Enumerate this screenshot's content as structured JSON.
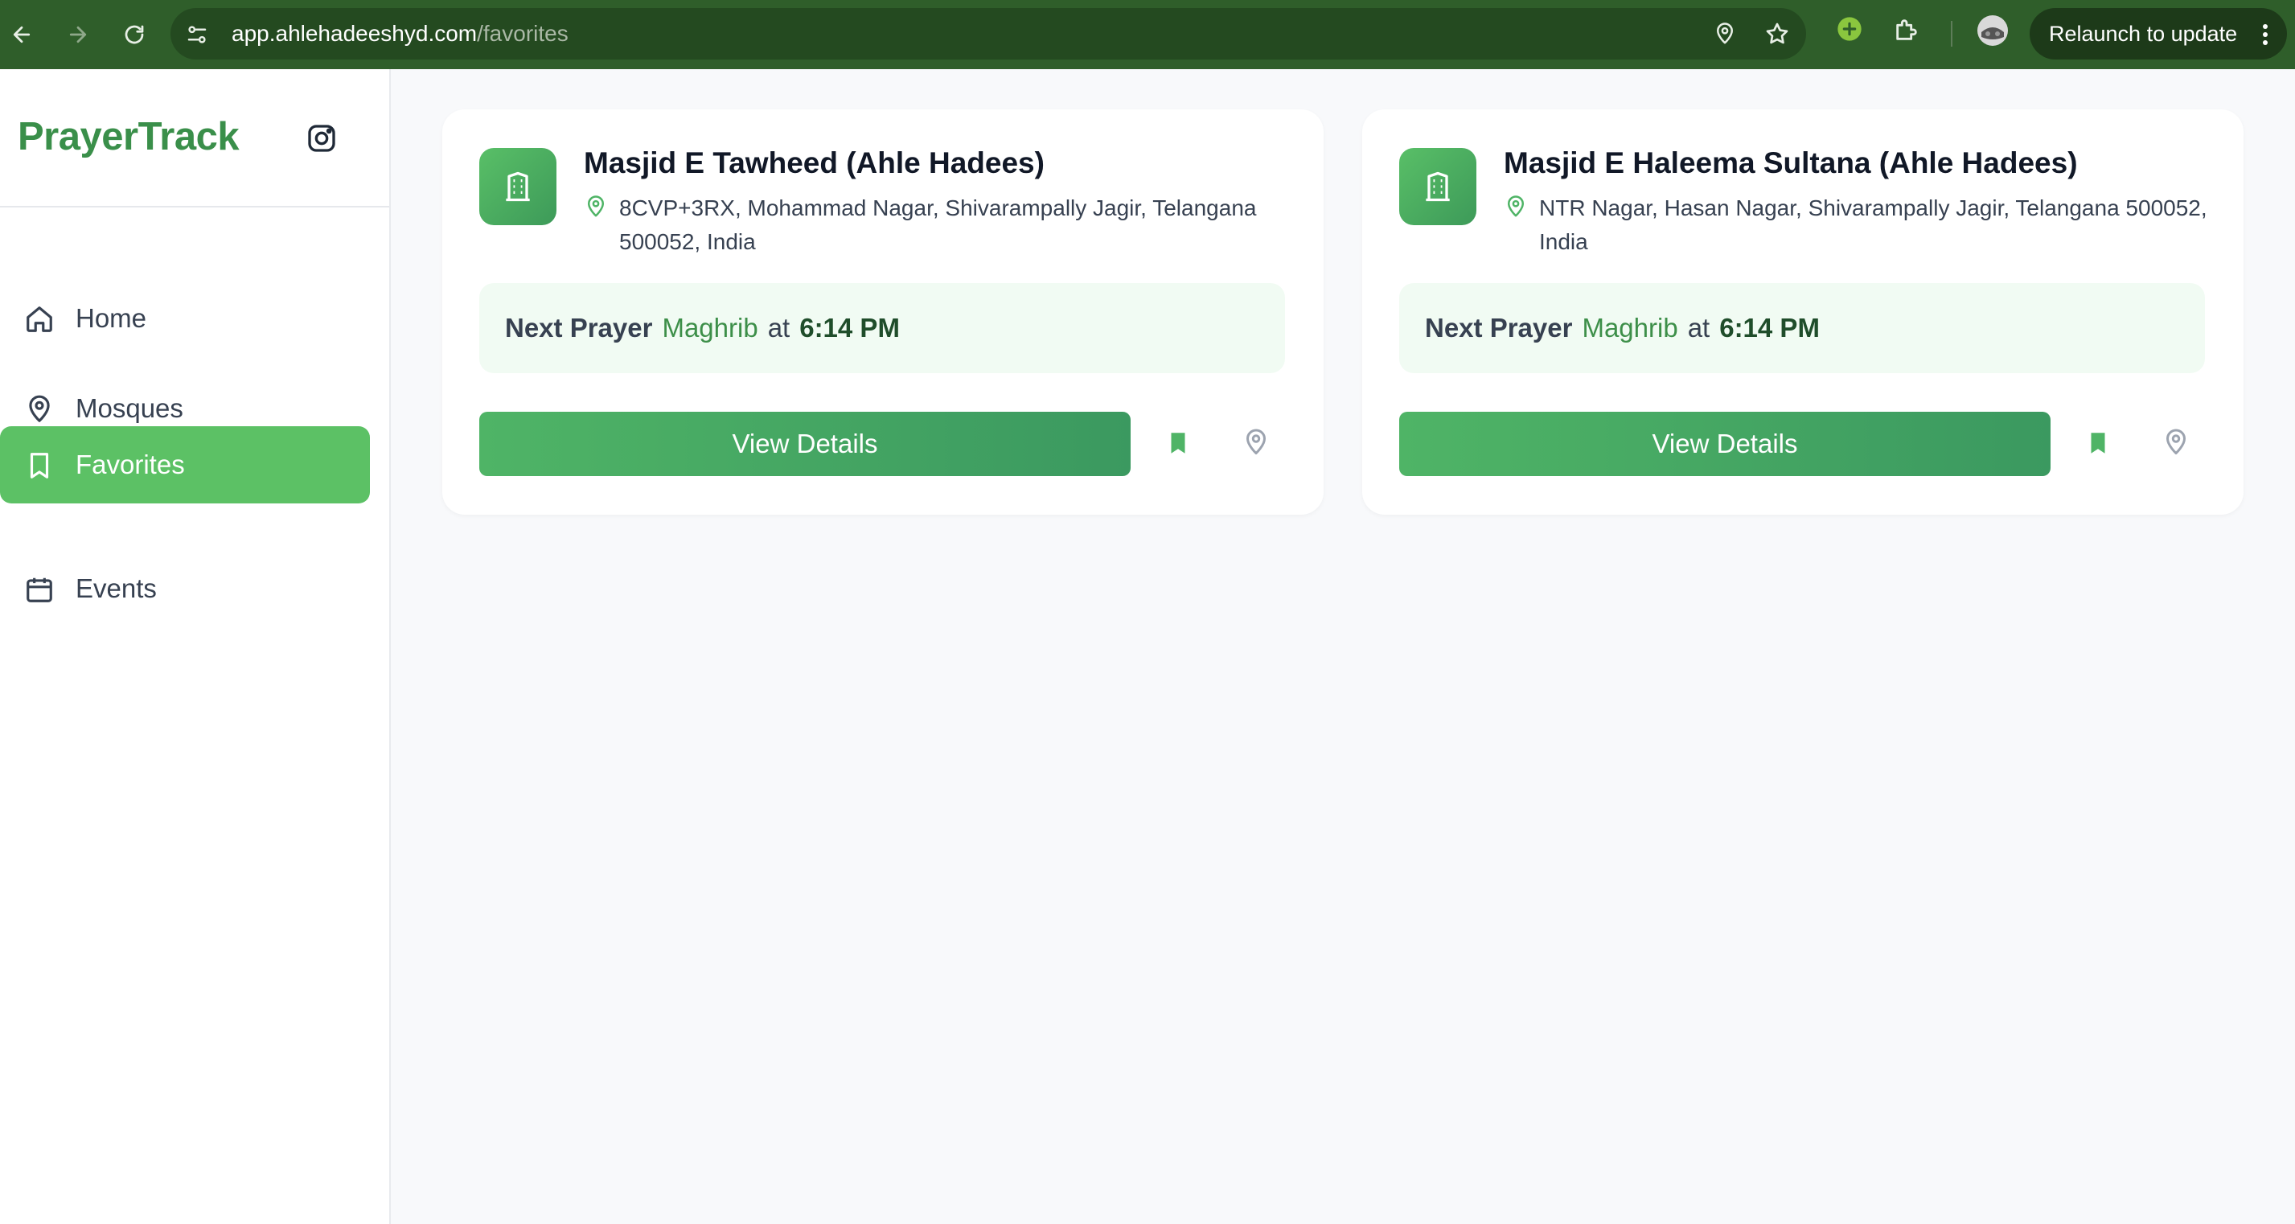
{
  "browser": {
    "url_host": "app.ahlehadeeshyd.com",
    "url_path": "/favorites",
    "relaunch_label": "Relaunch to update"
  },
  "sidebar": {
    "brand": "PrayerTrack",
    "items": [
      {
        "label": "Home",
        "icon": "home-icon"
      },
      {
        "label": "Mosques",
        "icon": "map-pin-icon"
      },
      {
        "label": "Favorites",
        "icon": "bookmark-icon",
        "active": true
      },
      {
        "label": "Events",
        "icon": "calendar-icon"
      }
    ]
  },
  "cards": [
    {
      "name": "Masjid E Tawheed (Ahle Hadees)",
      "address": "8CVP+3RX, Mohammad Nagar, Shivarampally Jagir, Telangana 500052, India",
      "next_prayer_label": "Next Prayer",
      "prayer_name": "Maghrib",
      "at_label": "at",
      "prayer_time": "6:14 PM",
      "button_label": "View Details"
    },
    {
      "name": "Masjid E Haleema Sultana (Ahle Hadees)",
      "address": "NTR Nagar, Hasan Nagar, Shivarampally Jagir, Telangana 500052, India",
      "next_prayer_label": "Next Prayer",
      "prayer_name": "Maghrib",
      "at_label": "at",
      "prayer_time": "6:14 PM",
      "button_label": "View Details"
    }
  ],
  "colors": {
    "brand": "#3a8f4a",
    "active_nav": "#5cc165",
    "chrome_bg": "#2f5e2a"
  }
}
